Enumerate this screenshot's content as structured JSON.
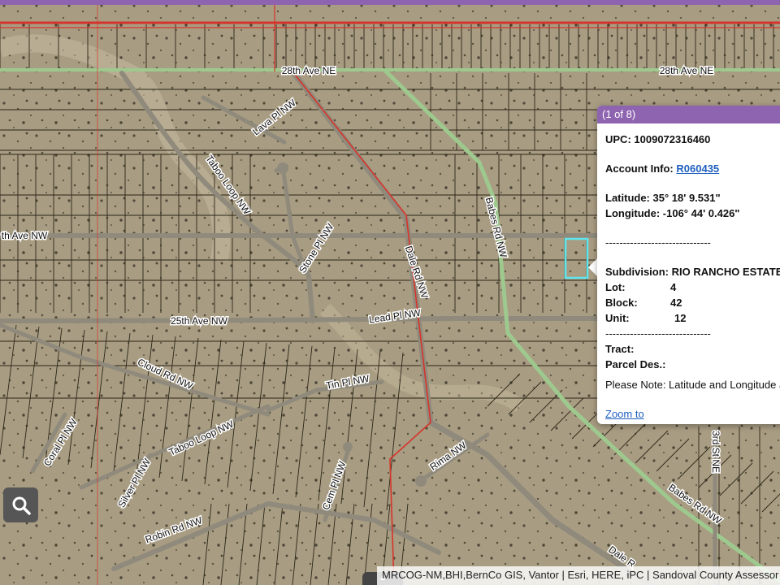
{
  "map": {
    "street_labels": [
      "28th Ave NE",
      "28th Ave NE",
      "Lava Pl NW",
      "Taboo Loop NW",
      "th Ave NW",
      "Stone Pl NW",
      "Dale Rd NW",
      "Lead Pl NW",
      "Babes Rd NW",
      "25th Ave NW",
      "Cloud Rd NW",
      "Tin Pl NW",
      "Coral Pl NW",
      "Taboo Loop NW",
      "Silver Pl NW",
      "Cem Pl NW",
      "Rima NW",
      "Robin Rd NW",
      "Dale R",
      "Babes Rd NW",
      "3rd St NE"
    ],
    "colors": {
      "terrain": "#a89c82",
      "parcel_line": "#2b2618",
      "road_fill": "#8f8a7c",
      "arterial_green": "#9ec98e",
      "boundary_red": "#d6342a",
      "selected_parcel": "#5fe6ec"
    }
  },
  "popup": {
    "header": "(1 of 8)",
    "upc_label": "UPC:",
    "upc_value": "1009072316460",
    "account_label": "Account Info:",
    "account_value": "R060435",
    "latitude_label": "Latitude:",
    "latitude_value": "35° 18' 9.531\"",
    "longitude_label": "Longitude:",
    "longitude_value": "-106° 44' 0.426\"",
    "separator": "------------------------------",
    "subdivision_label": "Subdivision:",
    "subdivision_value": "RIO RANCHO ESTATES",
    "lot_label": "Lot:",
    "lot_value": "4",
    "block_label": "Block:",
    "block_value": "42",
    "unit_label": "Unit:",
    "unit_value": "12",
    "tract_label": "Tract:",
    "parcel_des_label": "Parcel Des.:",
    "note": "Please Note: Latitude and Longitude are for the approximate center of the parcel shape.",
    "zoom_link": "Zoom to"
  },
  "controls": {
    "search_icon": "magnifier-icon",
    "expand_icon": "chevron-up-icon"
  },
  "attribution": "MRCOG-NM,BHI,BernCo GIS, Vantor | Esri, HERE, iPC | Sandoval County Assessor"
}
